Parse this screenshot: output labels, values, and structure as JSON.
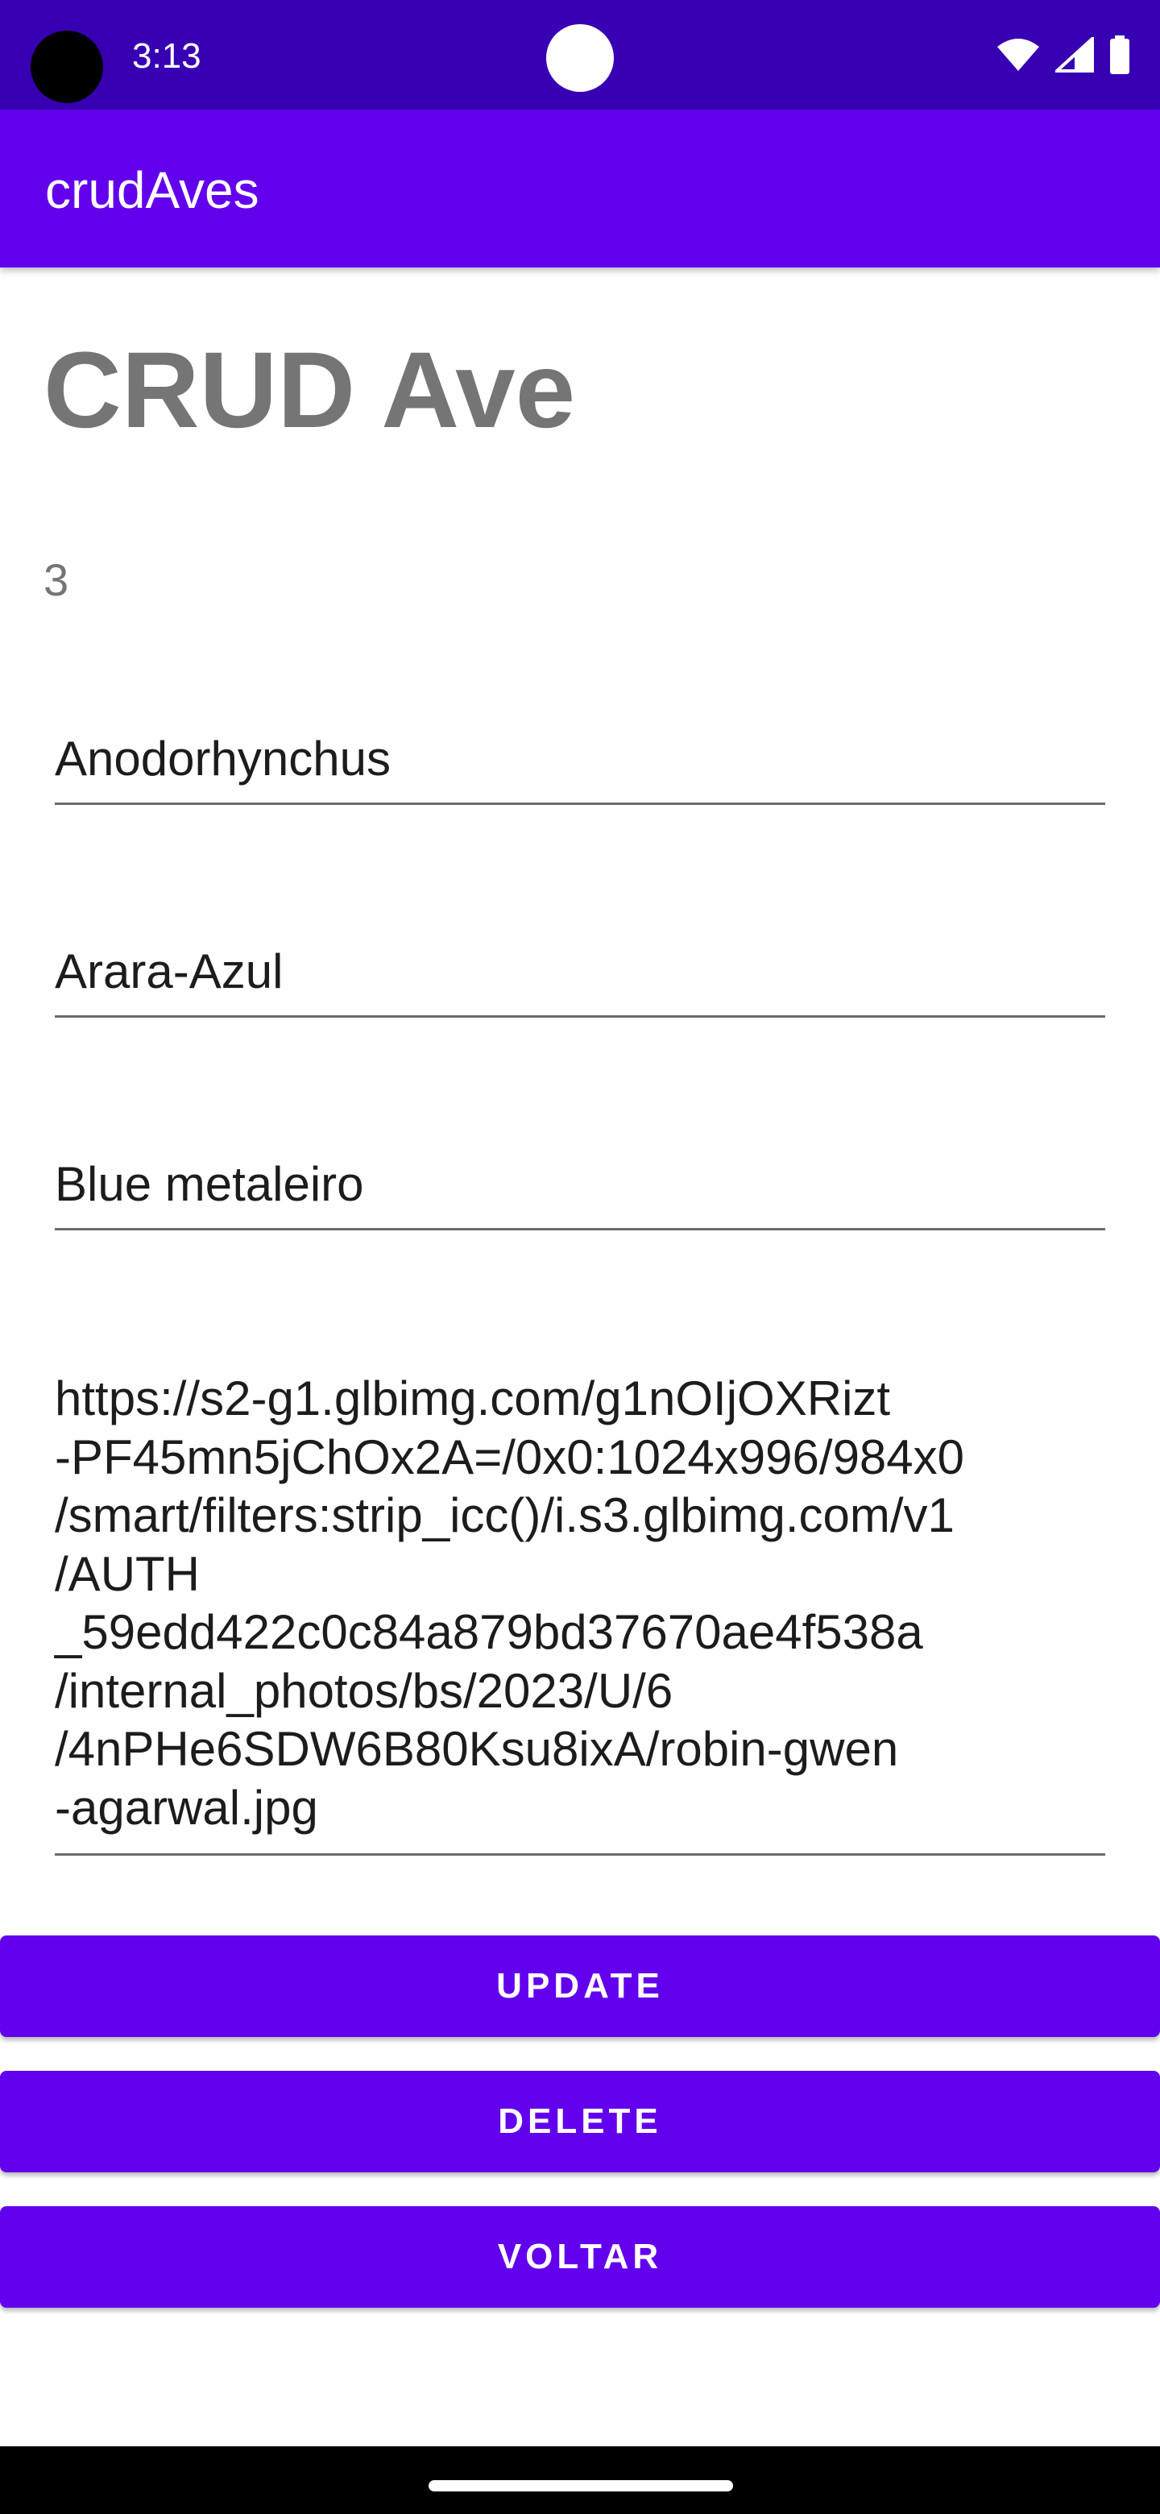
{
  "status_bar": {
    "time": "3:13",
    "icons": [
      "wifi-icon",
      "signal-icon",
      "battery-icon"
    ]
  },
  "app_bar": {
    "title": "crudAves"
  },
  "page": {
    "heading": "CRUD Ave",
    "record_id": "3"
  },
  "fields": {
    "genus": "Anodorhynchus",
    "common_name": "Arara-Azul",
    "nickname": "Blue metaleiro",
    "image_url": "https://s2-g1.glbimg.com/g1nOIjOXRizt\n-PF45mn5jChOx2A=/0x0:1024x996/984x0\n/smart/filters:strip_icc()/i.s3.glbimg.com/v1\n/AUTH\n_59edd422c0c84a879bd37670ae4f538a\n/internal_photos/bs/2023/U/6\n/4nPHe6SDW6B80Ksu8ixA/robin-gwen\n-agarwal.jpg"
  },
  "buttons": {
    "update": "UPDATE",
    "delete": "DELETE",
    "voltar": "VOLTAR"
  },
  "colors": {
    "status_bar": "#3700B3",
    "primary": "#6200EE",
    "heading_text": "#757575"
  }
}
